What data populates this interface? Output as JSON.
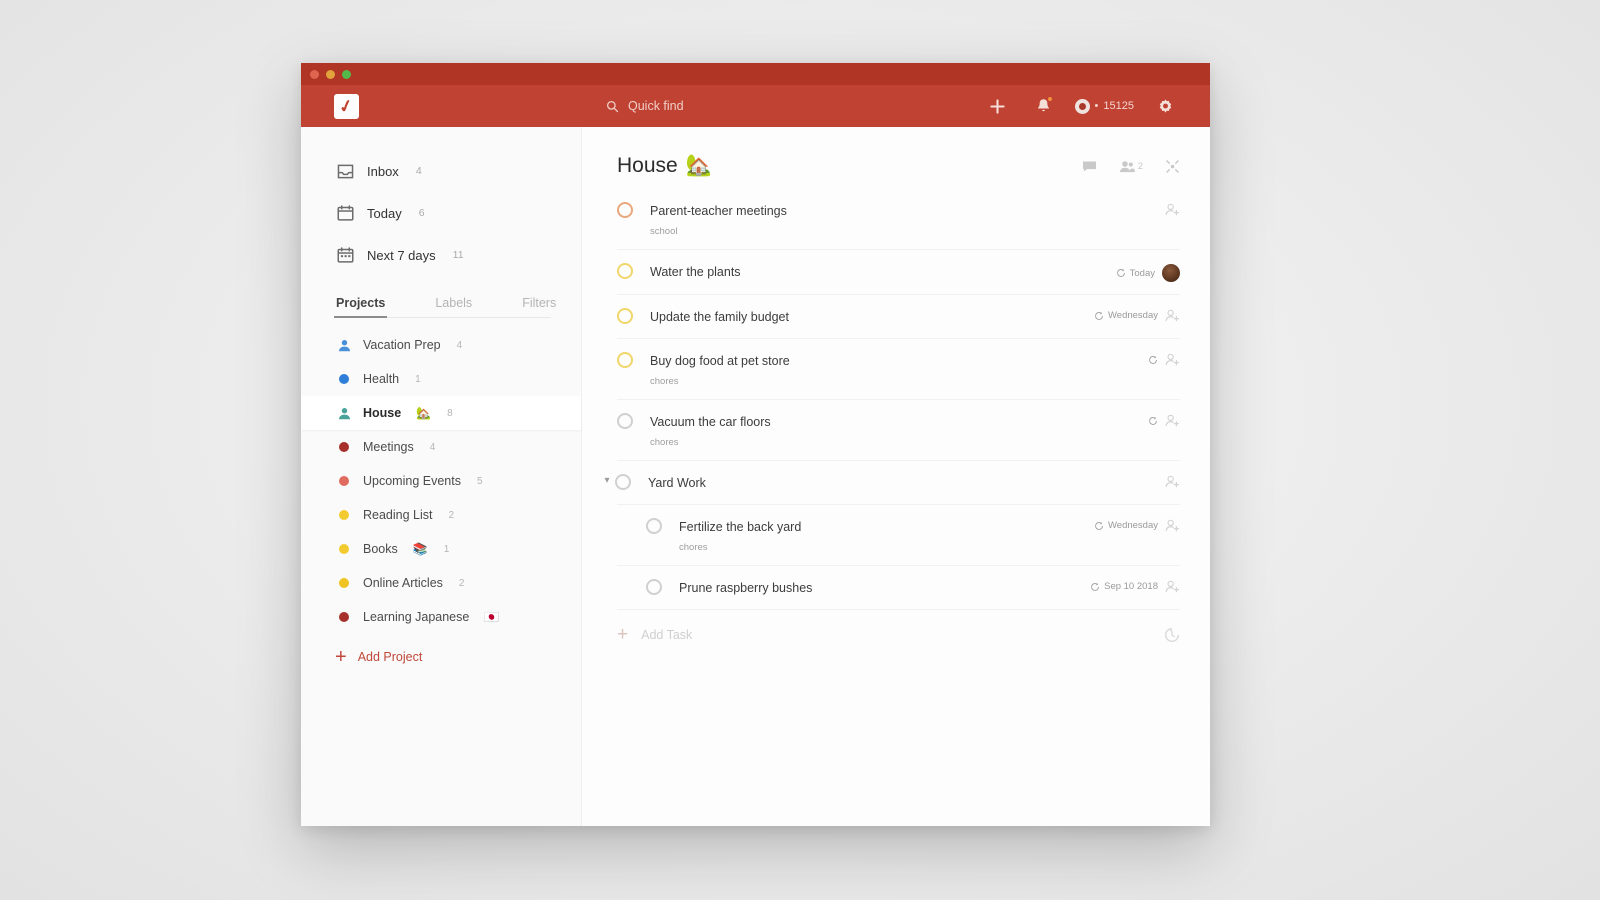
{
  "window": {
    "traffic_lights": [
      "close",
      "minimize",
      "maximize"
    ]
  },
  "toolbar": {
    "logo": "todoist-logo",
    "search_placeholder": "Quick find",
    "search_value": "",
    "add_label": "+",
    "notifications_icon": "bell-icon",
    "karma_points": "15125",
    "karma_prefix": "•",
    "settings_icon": "gear-icon"
  },
  "sidebar": {
    "nav": [
      {
        "label": "Inbox",
        "count": "4",
        "icon": "inbox-icon"
      },
      {
        "label": "Today",
        "count": "6",
        "icon": "calendar-icon"
      },
      {
        "label": "Next 7 days",
        "count": "11",
        "icon": "calendar-week-icon"
      }
    ],
    "tabs": [
      {
        "label": "Projects",
        "active": true
      },
      {
        "label": "Labels",
        "active": false
      },
      {
        "label": "Filters",
        "active": false
      }
    ],
    "projects": [
      {
        "label": "Vacation Prep",
        "emoji": "",
        "count": "4",
        "color": "#4a90d9",
        "shared": true,
        "selected": false
      },
      {
        "label": "Health",
        "emoji": "",
        "count": "1",
        "color": "#2f7ed8",
        "shared": false,
        "selected": false
      },
      {
        "label": "House",
        "emoji": "🏡",
        "count": "8",
        "color": "#4aa39a",
        "shared": true,
        "selected": true
      },
      {
        "label": "Meetings",
        "emoji": "",
        "count": "4",
        "color": "#a8302a",
        "shared": false,
        "selected": false
      },
      {
        "label": "Upcoming Events",
        "emoji": "",
        "count": "5",
        "color": "#e06b5f",
        "shared": false,
        "selected": false
      },
      {
        "label": "Reading List",
        "emoji": "",
        "count": "2",
        "color": "#f2cb30",
        "shared": false,
        "selected": false
      },
      {
        "label": "Books",
        "emoji": "📚",
        "count": "1",
        "color": "#f2cb30",
        "shared": false,
        "selected": false
      },
      {
        "label": "Online Articles",
        "emoji": "",
        "count": "2",
        "color": "#f0c420",
        "shared": false,
        "selected": false
      },
      {
        "label": "Learning Japanese",
        "emoji": "🇯🇵",
        "count": "",
        "color": "#a8302a",
        "shared": false,
        "selected": false
      }
    ],
    "add_project_label": "Add Project"
  },
  "main": {
    "project_title": "House",
    "project_emoji": "🏡",
    "header_actions": {
      "comments_icon": "comment-icon",
      "share_icon": "people-icon",
      "share_count": "2",
      "settings_icon": "wrench-icon"
    },
    "tasks": [
      {
        "title": "Parent-teacher meetings",
        "sublabel": "school",
        "priority": "p3",
        "due": "",
        "recurring": false,
        "avatar": false,
        "sub": false,
        "collapsible": false
      },
      {
        "title": "Water the plants",
        "sublabel": "",
        "priority": "p4",
        "due": "Today",
        "recurring": true,
        "avatar": true,
        "sub": false,
        "collapsible": false
      },
      {
        "title": "Update the family budget",
        "sublabel": "",
        "priority": "p4",
        "due": "Wednesday",
        "recurring": true,
        "avatar": false,
        "sub": false,
        "collapsible": false
      },
      {
        "title": "Buy dog food at pet store",
        "sublabel": "chores",
        "priority": "p4",
        "due": "",
        "recurring": true,
        "avatar": false,
        "sub": false,
        "collapsible": false
      },
      {
        "title": "Vacuum the car floors",
        "sublabel": "chores",
        "priority": "p5",
        "due": "",
        "recurring": true,
        "avatar": false,
        "sub": false,
        "collapsible": false
      },
      {
        "title": "Yard Work",
        "sublabel": "",
        "priority": "p5",
        "due": "",
        "recurring": false,
        "avatar": false,
        "sub": false,
        "collapsible": true
      },
      {
        "title": "Fertilize the back yard",
        "sublabel": "chores",
        "priority": "p5",
        "due": "Wednesday",
        "recurring": true,
        "avatar": false,
        "sub": true,
        "collapsible": false
      },
      {
        "title": "Prune raspberry bushes",
        "sublabel": "",
        "priority": "p5",
        "due": "Sep 10 2018",
        "recurring": true,
        "avatar": false,
        "sub": true,
        "collapsible": false
      }
    ],
    "add_task_label": "Add Task",
    "history_icon": "history-icon"
  }
}
